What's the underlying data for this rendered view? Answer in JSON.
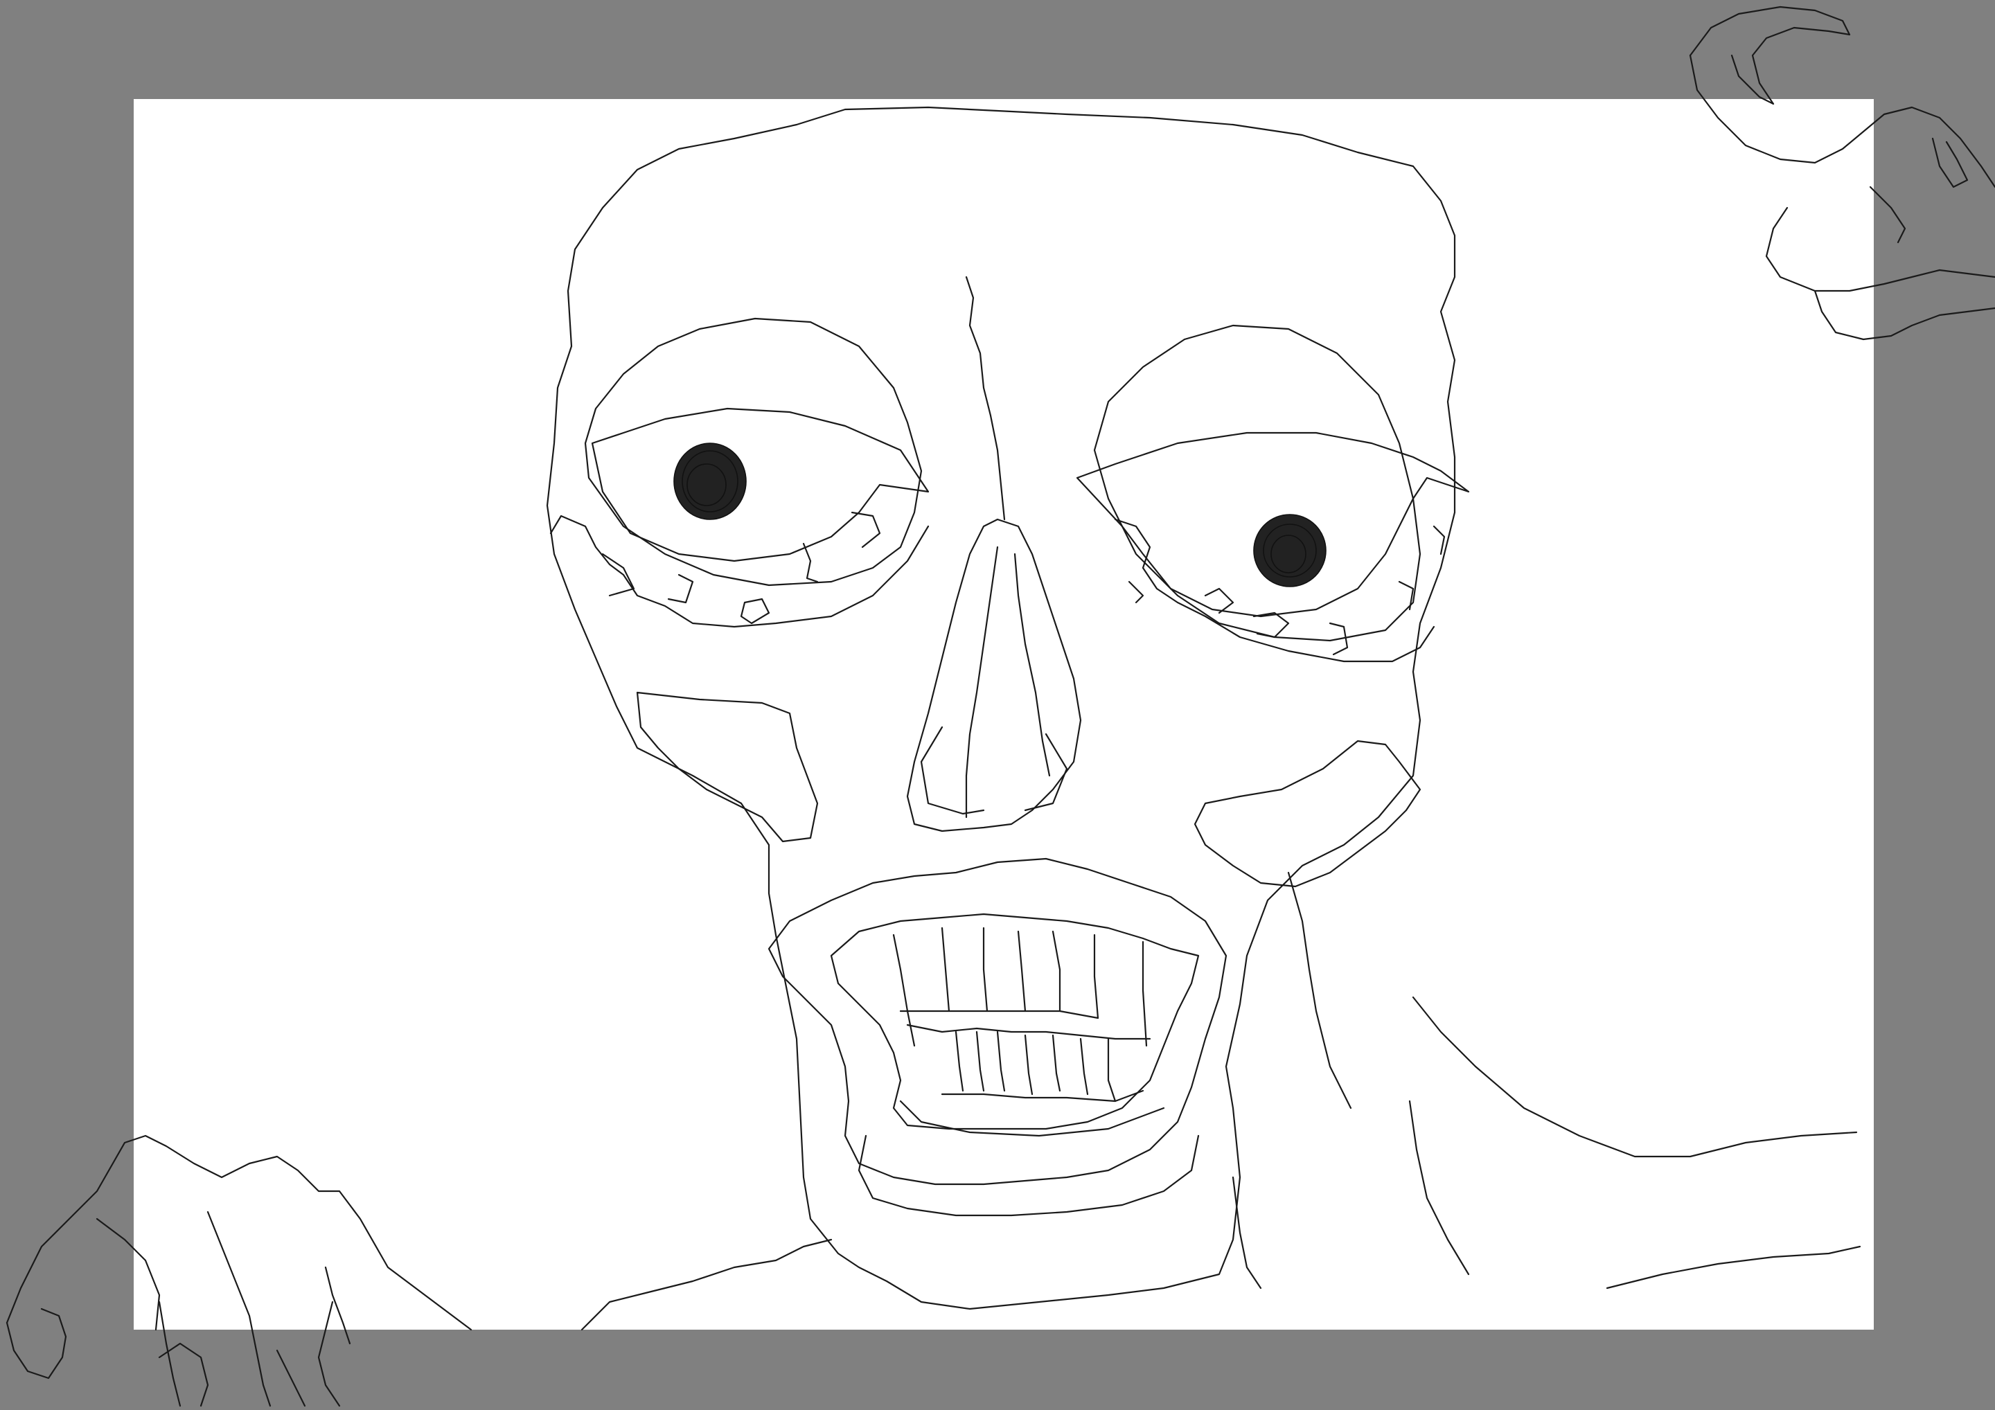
{
  "app": {
    "canvas_background": "#ffffff",
    "workspace_background": "#808080",
    "stroke_color": "#1a1a1a"
  },
  "drawing": {
    "subject_icon": "line-drawing-creature-face"
  }
}
